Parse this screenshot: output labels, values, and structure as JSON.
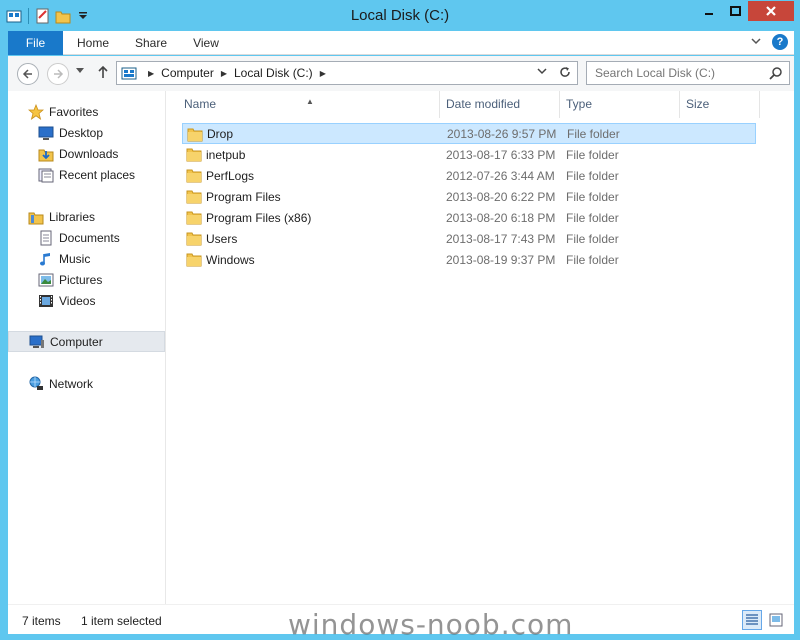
{
  "window": {
    "title": "Local Disk (C:)",
    "accent": "#5fc7ef",
    "close_color": "#c7463a"
  },
  "ribbon": {
    "tabs": [
      "File",
      "Home",
      "Share",
      "View"
    ],
    "file_color": "#1979ca"
  },
  "address": {
    "crumbs": [
      "Computer",
      "Local Disk (C:)"
    ]
  },
  "search": {
    "placeholder": "Search Local Disk (C:)"
  },
  "navpane": {
    "favorites": {
      "label": "Favorites",
      "items": [
        "Desktop",
        "Downloads",
        "Recent places"
      ]
    },
    "libraries": {
      "label": "Libraries",
      "items": [
        "Documents",
        "Music",
        "Pictures",
        "Videos"
      ]
    },
    "computer": "Computer",
    "network": "Network"
  },
  "columns": [
    "Name",
    "Date modified",
    "Type",
    "Size"
  ],
  "files": [
    {
      "name": "Drop",
      "date": "2013-08-26 9:57 PM",
      "type": "File folder",
      "selected": true
    },
    {
      "name": "inetpub",
      "date": "2013-08-17 6:33 PM",
      "type": "File folder"
    },
    {
      "name": "PerfLogs",
      "date": "2012-07-26 3:44 AM",
      "type": "File folder"
    },
    {
      "name": "Program Files",
      "date": "2013-08-20 6:22 PM",
      "type": "File folder"
    },
    {
      "name": "Program Files (x86)",
      "date": "2013-08-20 6:18 PM",
      "type": "File folder"
    },
    {
      "name": "Users",
      "date": "2013-08-17 7:43 PM",
      "type": "File folder"
    },
    {
      "name": "Windows",
      "date": "2013-08-19 9:37 PM",
      "type": "File folder"
    }
  ],
  "status": {
    "items_count": "7 items",
    "selection": "1 item selected"
  },
  "watermark": "windows-noob.com"
}
